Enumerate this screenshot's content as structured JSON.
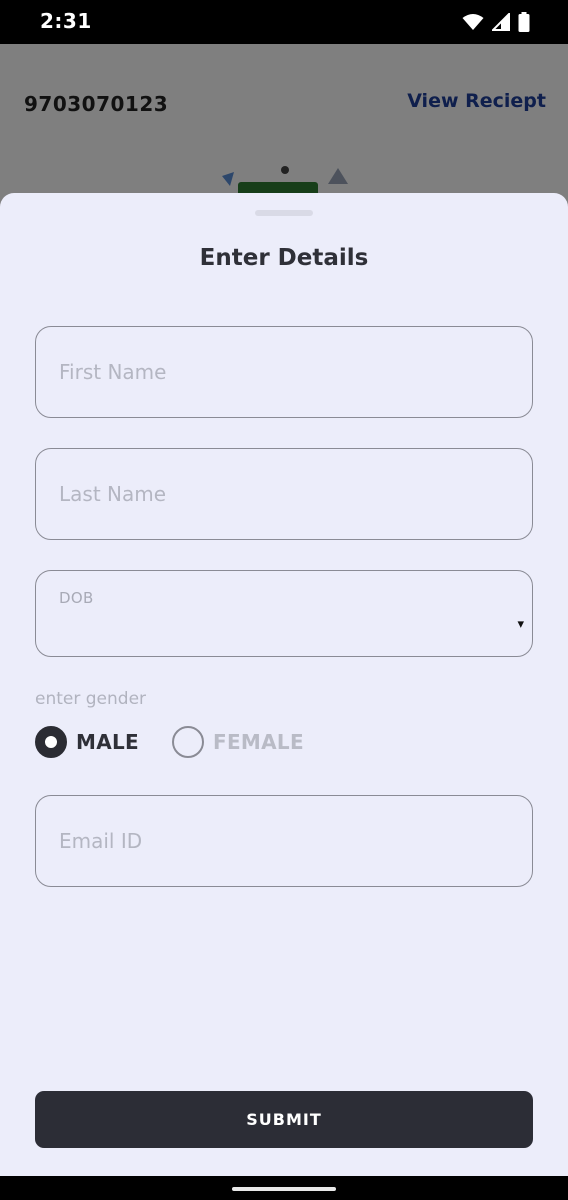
{
  "status_bar": {
    "time": "2:31",
    "icons": [
      "wifi-icon",
      "cellular-signal-icon",
      "battery-icon"
    ]
  },
  "background": {
    "phone_number": "9703070123",
    "view_receipt_link": "View Reciept"
  },
  "sheet": {
    "title": "Enter Details",
    "first_name": {
      "placeholder": "First Name",
      "value": ""
    },
    "last_name": {
      "placeholder": "Last Name",
      "value": ""
    },
    "dob": {
      "label": "DOB",
      "value": "",
      "caret": "▾"
    },
    "gender": {
      "label": "enter gender",
      "options": [
        {
          "label": "MALE",
          "selected": true
        },
        {
          "label": "FEMALE",
          "selected": false
        }
      ]
    },
    "email": {
      "placeholder": "Email ID",
      "value": ""
    },
    "submit_label": "SUBMIT"
  },
  "colors": {
    "sheet_background": "#ecedfa",
    "primary_dark": "#2c2d36",
    "link_blue": "#1f3f9a",
    "field_border": "#8a8b95"
  }
}
